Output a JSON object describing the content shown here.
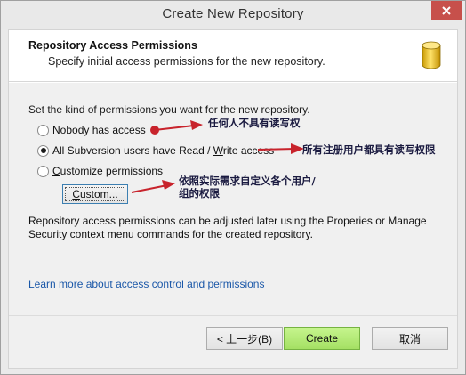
{
  "window": {
    "title": "Create New Repository"
  },
  "header": {
    "title": "Repository Access Permissions",
    "subtitle": "Specify initial access permissions for the new repository."
  },
  "body": {
    "intro": "Set the kind of permissions you want for the new repository.",
    "options": [
      {
        "pre": "",
        "key": "N",
        "post": "obody has access",
        "checked": false
      },
      {
        "pre": "All Subversion users have Read / ",
        "key": "W",
        "post": "rite access",
        "checked": true
      },
      {
        "pre": "",
        "key": "C",
        "post": "ustomize permissions",
        "checked": false
      }
    ],
    "custom_button": {
      "key": "C",
      "post": "ustom..."
    },
    "note": "Repository access permissions can be adjusted later using the Properies or Manage Security context menu commands for the created repository.",
    "learn_more": "Learn more about access control and permissions"
  },
  "footer": {
    "back": "< 上一步(B)",
    "create": "Create",
    "cancel": "取消"
  },
  "annotations": {
    "a1": "任何人不具有读写权",
    "a2": "所有注册用户都具有读写权限",
    "a3_line1": "依照实际需求自定义各个用户/",
    "a3_line2": "组的权限",
    "color": "#c8232c"
  },
  "icons": {
    "close": "close-icon",
    "database": "database-icon"
  }
}
